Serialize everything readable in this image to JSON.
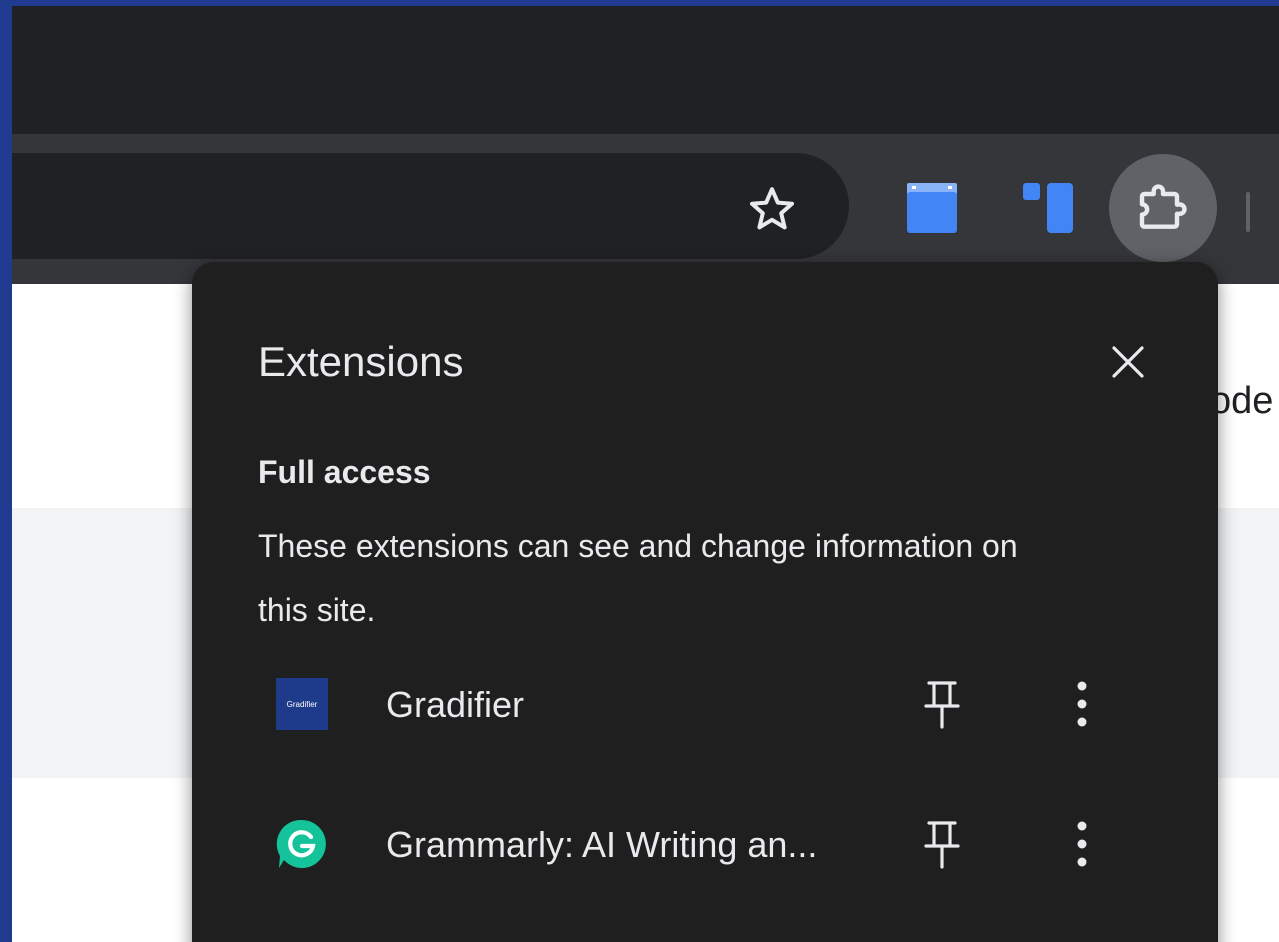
{
  "page": {
    "visible_fragment": "ode"
  },
  "toolbar": {
    "icons": [
      "star-icon",
      "folder-extension-icon",
      "trello-extension-icon",
      "puzzle-icon"
    ]
  },
  "extensions_menu": {
    "title": "Extensions",
    "section_title": "Full access",
    "section_description": "These extensions can see and change information on this site.",
    "items": [
      {
        "name": "Gradifier",
        "icon_text": "Gradifier",
        "icon": "gradifier-icon"
      },
      {
        "name": "Grammarly: AI Writing an...",
        "icon": "grammarly-icon"
      }
    ]
  },
  "colors": {
    "background_frame": "#1f3a8e",
    "menu_bg": "#1f1f1f",
    "menu_text": "#e8eaed",
    "extension_blue": "#4285f4",
    "gradifier_blue": "#1e3a8a",
    "grammarly_green": "#15c39a"
  }
}
